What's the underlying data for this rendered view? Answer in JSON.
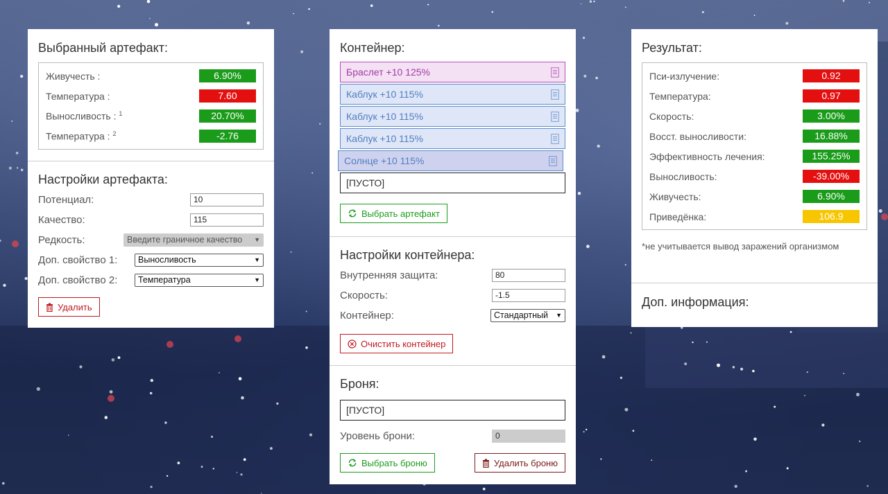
{
  "selected": {
    "title": "Выбранный артефакт:",
    "stats": [
      {
        "label": "Живучесть :",
        "sup": "",
        "value": "6.90%",
        "color": "green"
      },
      {
        "label": "Температура :",
        "sup": "",
        "value": "7.60",
        "color": "red"
      },
      {
        "label": "Выносливость :",
        "sup": "1",
        "value": "20.70%",
        "color": "green"
      },
      {
        "label": "Температура :",
        "sup": "2",
        "value": "-2.76",
        "color": "green"
      }
    ]
  },
  "artifact_settings": {
    "title": "Настройки артефакта:",
    "potential_label": "Потенциал:",
    "potential_value": "10",
    "quality_label": "Качество:",
    "quality_value": "115",
    "rarity_label": "Редкость:",
    "rarity_value": "Введите граничное качество",
    "extra1_label": "Доп. свойство 1:",
    "extra1_value": "Выносливость",
    "extra2_label": "Доп. свойство 2:",
    "extra2_value": "Температура",
    "delete_label": "Удалить"
  },
  "container": {
    "title": "Контейнер:",
    "slots": [
      {
        "label": "Браслет +10 125%",
        "style": "pink"
      },
      {
        "label": "Каблук +10 115%",
        "style": "blue"
      },
      {
        "label": "Каблук +10 115%",
        "style": "blue"
      },
      {
        "label": "Каблук +10 115%",
        "style": "blue"
      },
      {
        "label": "Солнце +10 115%",
        "style": "violet"
      }
    ],
    "empty_label": "[ПУСТО]",
    "choose_label": "Выбрать артефакт"
  },
  "container_settings": {
    "title": "Настройки контейнера:",
    "inner_protection_label": "Внутренняя защита:",
    "inner_protection_value": "80",
    "speed_label": "Скорость:",
    "speed_value": "-1.5",
    "container_label": "Контейнер:",
    "container_value": "Стандартный",
    "clear_label": "Очистить контейнер"
  },
  "armor": {
    "title": "Броня:",
    "empty_label": "[ПУСТО]",
    "level_label": "Уровень брони:",
    "level_value": "0",
    "choose_label": "Выбрать броню",
    "delete_label": "Удалить броню"
  },
  "result": {
    "title": "Результат:",
    "stats": [
      {
        "label": "Пси-излучение:",
        "value": "0.92",
        "color": "red"
      },
      {
        "label": "Температура:",
        "value": "0.97",
        "color": "red"
      },
      {
        "label": "Скорость:",
        "value": "3.00%",
        "color": "green"
      },
      {
        "label": "Восст. выносливости:",
        "value": "16.88%",
        "color": "green"
      },
      {
        "label": "Эффективность лечения:",
        "value": "155.25%",
        "color": "green"
      },
      {
        "label": "Выносливость:",
        "value": "-39.00%",
        "color": "red"
      },
      {
        "label": "Живучесть:",
        "value": "6.90%",
        "color": "green"
      },
      {
        "label": "Приведёнка:",
        "value": "106.9",
        "color": "yellow"
      }
    ],
    "note": "*не учитывается вывод заражений организмом",
    "extra_title": "Доп. информация:"
  },
  "colors": {
    "green": "#1a9c1a",
    "red": "#e41010",
    "yellow": "#f7c600"
  }
}
